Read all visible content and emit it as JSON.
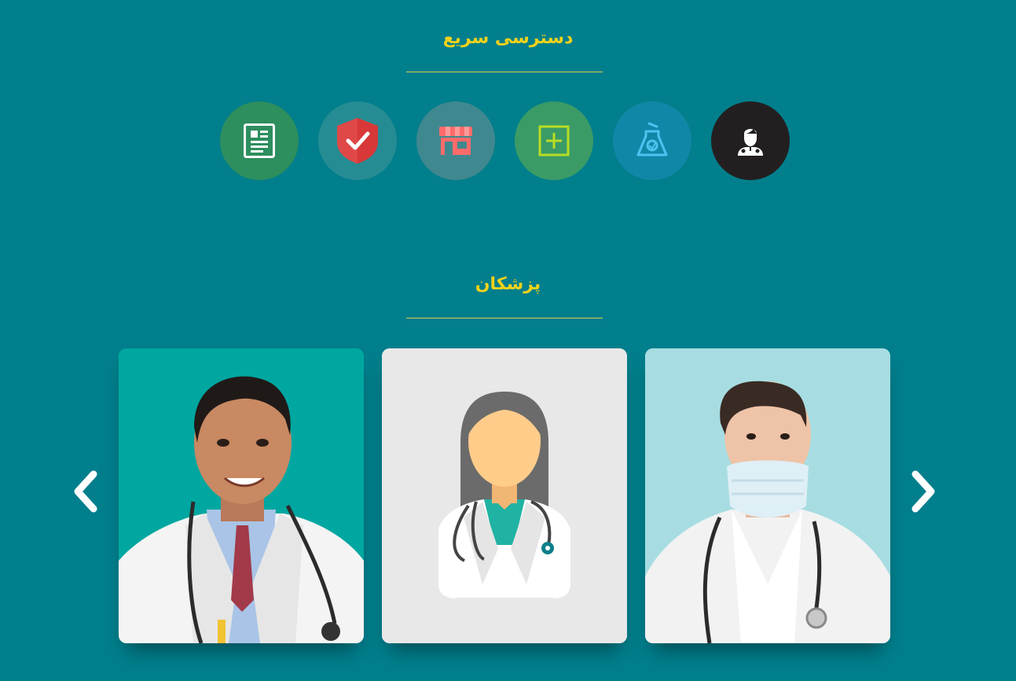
{
  "quick_access": {
    "title": "دسترسی سریع",
    "items": [
      {
        "name": "doctor",
        "icon": "doctor-icon",
        "bg": "#231f20",
        "fg": "#ffffff"
      },
      {
        "name": "lab",
        "icon": "lab-flask-icon",
        "bg": "#1187a8",
        "fg": "#4cc3f0"
      },
      {
        "name": "add",
        "icon": "plus-square-icon",
        "bg": "#3a9b66",
        "fg": "#b8dd23"
      },
      {
        "name": "store",
        "icon": "storefront-icon",
        "bg": "#40888f",
        "fg": "#ff6b6b"
      },
      {
        "name": "insurance",
        "icon": "shield-check-icon",
        "bg": "#268c93",
        "fg": "#d83838"
      },
      {
        "name": "news",
        "icon": "document-icon",
        "bg": "#2d8e5e",
        "fg": "#ffffff"
      }
    ]
  },
  "doctors": {
    "title": "پزشکان",
    "prev_arrow": "chevron-left-icon",
    "next_arrow": "chevron-right-icon",
    "cards": [
      {
        "name": "doctor-male-smiling",
        "bg": "#00a7a0"
      },
      {
        "name": "doctor-female-avatar",
        "bg": "#e8e8e8"
      },
      {
        "name": "doctor-male-masked",
        "bg": "#a7dde2"
      }
    ]
  },
  "colors": {
    "background": "#017f8c",
    "title": "#f2d21b",
    "divider": "#d8cf47"
  }
}
